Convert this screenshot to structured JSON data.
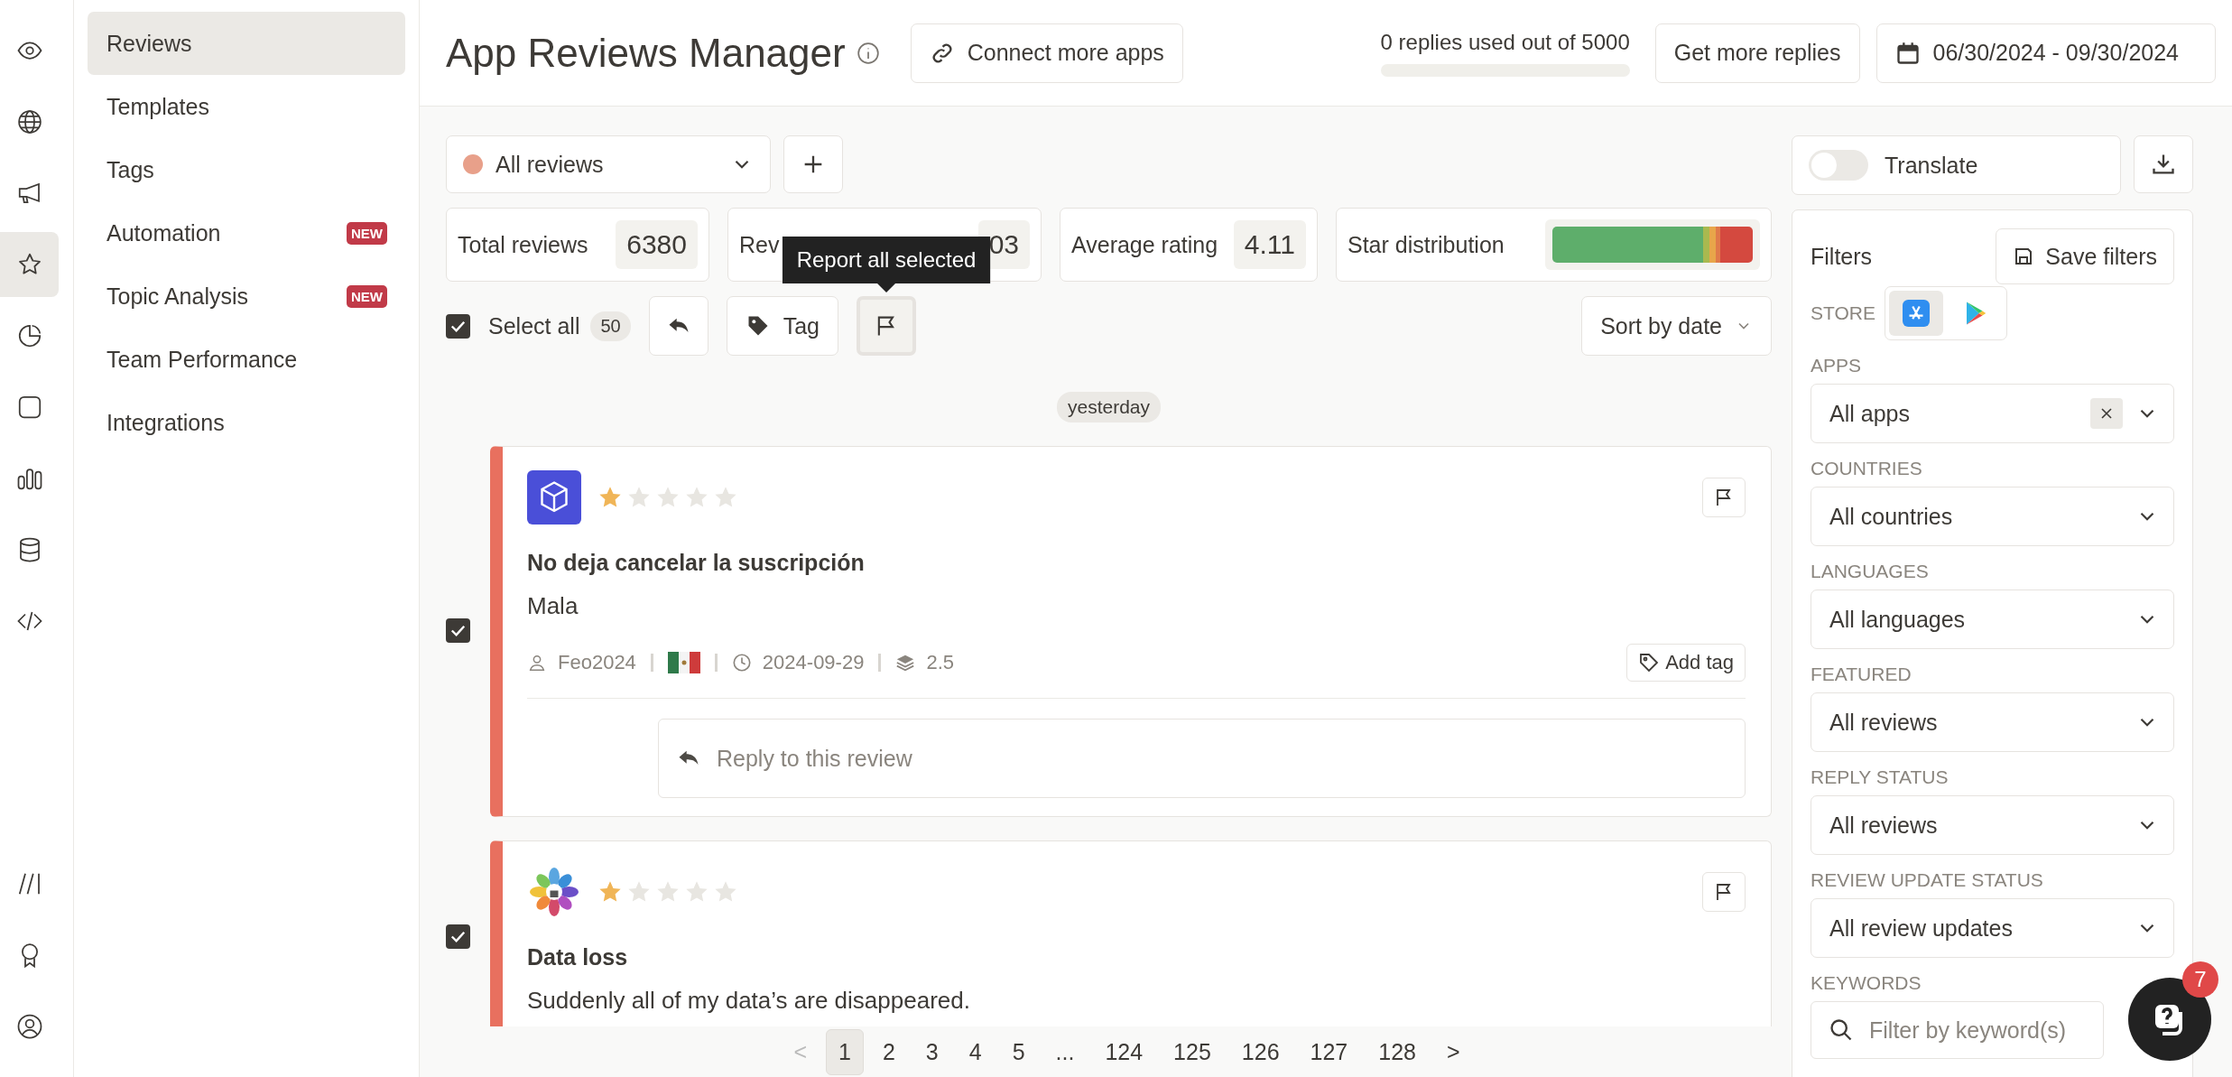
{
  "rail": {
    "top": [
      {
        "selected": false
      },
      {
        "selected": false
      },
      {
        "selected": false
      },
      {
        "selected": true
      },
      {
        "selected": false
      },
      {
        "selected": false
      },
      {
        "selected": false
      },
      {
        "selected": false
      },
      {
        "selected": false
      }
    ]
  },
  "nav": [
    {
      "label": "Reviews",
      "selected": true
    },
    {
      "label": "Templates",
      "selected": false
    },
    {
      "label": "Tags",
      "selected": false
    },
    {
      "label": "Automation",
      "selected": false,
      "badge": "NEW"
    },
    {
      "label": "Topic Analysis",
      "selected": false,
      "badge": "NEW"
    },
    {
      "label": "Team Performance",
      "selected": false
    },
    {
      "label": "Integrations",
      "selected": false
    }
  ],
  "header": {
    "title": "App Reviews Manager",
    "connect_button": "Connect more apps",
    "replies": {
      "text": "0 replies used out of 5000",
      "level": 0
    },
    "get_more_button": "Get more replies",
    "date_range": "06/30/2024 - 09/30/2024"
  },
  "view_select": {
    "label": "All reviews"
  },
  "translate": {
    "label": "Translate",
    "on": false
  },
  "stats": [
    {
      "kind": "value",
      "label": "Total reviews",
      "value": "6380"
    },
    {
      "kind": "value",
      "label": "Rev",
      "value": "03"
    },
    {
      "kind": "value",
      "label": "Average rating",
      "value": "4.11"
    },
    {
      "kind": "distribution",
      "label": "Star distribution"
    }
  ],
  "actions": {
    "select_all": {
      "label": "Select all",
      "checked": true,
      "count": "50"
    },
    "tag_button": "Tag",
    "tooltip": "Report all selected",
    "sort": "Sort by date"
  },
  "date_chip": "yesterday",
  "reviews": [
    {
      "checked": true,
      "stars": 1,
      "title": "No deja cancelar la suscripción",
      "body": "Mala",
      "author": "Feo2024",
      "date": "2024-09-29",
      "version": "2.5",
      "add_tag": "Add tag",
      "reply_placeholder": "Reply to this review"
    },
    {
      "checked": true,
      "stars": 1,
      "title": "Data loss",
      "body": "Suddenly all of my data’s are disappeared."
    }
  ],
  "filters": {
    "title": "Filters",
    "save_button": "Save filters",
    "store_label": "STORE",
    "stores": [
      {
        "selected": true
      },
      {
        "selected": false
      }
    ],
    "fields": [
      {
        "label": "APPS",
        "value": "All apps",
        "clearable": true
      },
      {
        "label": "COUNTRIES",
        "value": "All countries",
        "clearable": false
      },
      {
        "label": "LANGUAGES",
        "value": "All languages",
        "clearable": false
      },
      {
        "label": "FEATURED",
        "value": "All reviews",
        "clearable": false
      },
      {
        "label": "REPLY STATUS",
        "value": "All reviews",
        "clearable": false
      },
      {
        "label": "REVIEW UPDATE STATUS",
        "value": "All review updates",
        "clearable": false
      }
    ],
    "keywords": {
      "label": "KEYWORDS",
      "placeholder": "Filter by keyword(s)"
    }
  },
  "pagination": {
    "prev": "<",
    "pages": [
      {
        "label": "1",
        "selected": true
      },
      {
        "label": "2",
        "selected": false
      },
      {
        "label": "3",
        "selected": false
      },
      {
        "label": "4",
        "selected": false
      },
      {
        "label": "5",
        "selected": false
      },
      {
        "label": "...",
        "selected": false
      },
      {
        "label": "124",
        "selected": false
      },
      {
        "label": "125",
        "selected": false
      },
      {
        "label": "126",
        "selected": false
      },
      {
        "label": "127",
        "selected": false
      },
      {
        "label": "128",
        "selected": false
      }
    ],
    "next": ">"
  },
  "help_badge": "7"
}
